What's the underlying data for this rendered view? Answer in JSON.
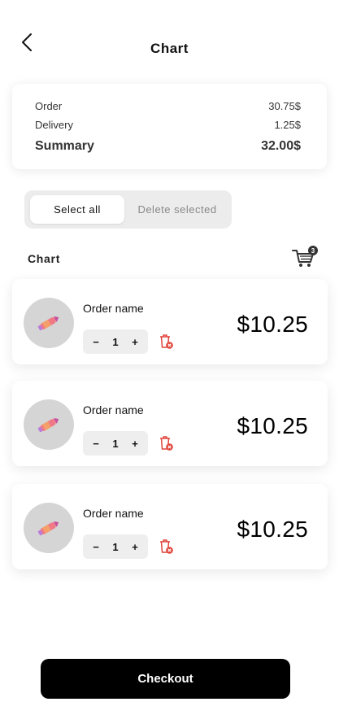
{
  "header": {
    "title": "Chart"
  },
  "summary": {
    "order_label": "Order",
    "order_value": "30.75$",
    "delivery_label": "Delivery",
    "delivery_value": "1.25$",
    "summary_label": "Summary",
    "summary_value": "32.00$"
  },
  "selection": {
    "select_all": "Select all",
    "delete_selected": "Delete selected"
  },
  "cart": {
    "label": "Chart",
    "badge_count": "3"
  },
  "items": [
    {
      "name": "Order name",
      "qty": "1",
      "price": "$10.25",
      "minus": "−",
      "plus": "+"
    },
    {
      "name": "Order name",
      "qty": "1",
      "price": "$10.25",
      "minus": "−",
      "plus": "+"
    },
    {
      "name": "Order name",
      "qty": "1",
      "price": "$10.25",
      "minus": "−",
      "plus": "+"
    }
  ],
  "checkout": {
    "label": "Checkout"
  },
  "colors": {
    "accent": "#000000",
    "danger": "#e0433a",
    "avatar_bg": "#d5d5d5",
    "segment_bg": "#ececec"
  },
  "icons": {
    "back": "chevron-left-icon",
    "cart": "cart-icon",
    "trash": "trash-icon",
    "product": "pen-icon"
  }
}
